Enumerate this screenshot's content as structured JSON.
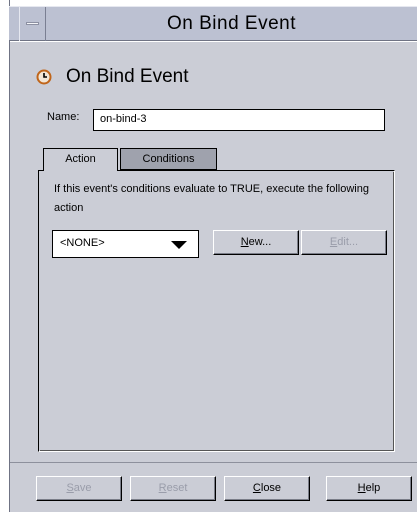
{
  "window": {
    "title": "On Bind Event"
  },
  "header": {
    "title": "On Bind Event",
    "icon": "clock-icon"
  },
  "form": {
    "name_label": "Name:",
    "name_value": "on-bind-3"
  },
  "tabs": [
    {
      "label": "Action",
      "selected": true
    },
    {
      "label": "Conditions",
      "selected": false
    }
  ],
  "action_panel": {
    "description": "If this event's conditions evaluate to TRUE, execute the following action",
    "action_select": {
      "selected": "<NONE>"
    },
    "new_button": {
      "mnemonic": "N",
      "rest": "ew..."
    },
    "edit_button": {
      "mnemonic": "E",
      "rest": "dit..."
    }
  },
  "footer": {
    "save": {
      "mnemonic": "S",
      "rest": "ave"
    },
    "reset": {
      "mnemonic": "R",
      "rest": "eset"
    },
    "close": {
      "mnemonic": "C",
      "rest": "lose"
    },
    "help": {
      "mnemonic": "H",
      "rest": "elp"
    }
  },
  "colors": {
    "panel": "#cbcdd6",
    "titlebar": "#bcc1d2",
    "icon_accent": "#c0651a"
  }
}
